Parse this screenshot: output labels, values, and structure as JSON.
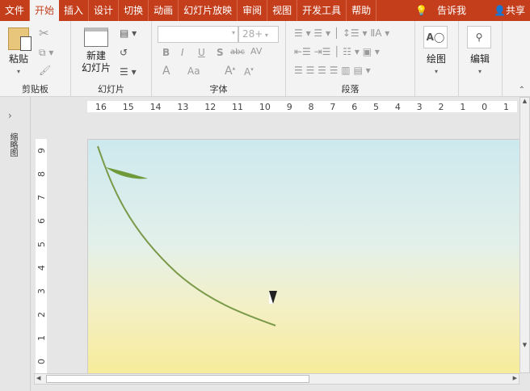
{
  "tabs": [
    "文件",
    "开始",
    "插入",
    "设计",
    "切换",
    "动画",
    "幻灯片放映",
    "审阅",
    "视图",
    "开发工具",
    "帮助"
  ],
  "tell_me": "告诉我",
  "share": "共享",
  "clipboard": {
    "paste": "粘贴",
    "label": "剪贴板"
  },
  "slides": {
    "new_line1": "新建",
    "new_line2": "幻灯片",
    "label": "幻灯片"
  },
  "font": {
    "size": "28+",
    "label": "字体",
    "bold": "B",
    "italic": "I",
    "underline": "U",
    "shadow": "S",
    "strike": "abc",
    "spacing": "AV",
    "color": "A",
    "case": "Aa"
  },
  "paragraph": {
    "label": "段落"
  },
  "drawing": {
    "label": "绘图"
  },
  "editing": {
    "label": "编辑"
  },
  "thumbnail_pane": "缩略图",
  "h_ruler": [
    "16",
    "15",
    "14",
    "13",
    "12",
    "11",
    "10",
    "9",
    "8",
    "7",
    "6",
    "5",
    "4",
    "3",
    "2",
    "1",
    "0",
    "1"
  ],
  "v_ruler": [
    "9",
    "8",
    "7",
    "6",
    "5",
    "4",
    "3",
    "2",
    "1",
    "0"
  ]
}
